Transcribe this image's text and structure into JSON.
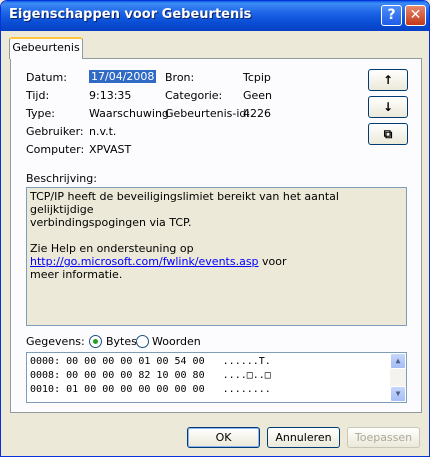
{
  "window": {
    "title": "Eigenschappen voor Gebeurtenis",
    "help_glyph": "?",
    "close_glyph": "✕"
  },
  "tab": {
    "label": "Gebeurtenis"
  },
  "fields": {
    "datum_label": "Datum:",
    "datum_value": "17/04/2008",
    "tijd_label": "Tijd:",
    "tijd_value": "9:13:35",
    "type_label": "Type:",
    "type_value": "Waarschuwing",
    "gebruiker_label": "Gebruiker:",
    "gebruiker_value": "n.v.t.",
    "computer_label": "Computer:",
    "computer_value": "XPVAST",
    "bron_label": "Bron:",
    "bron_value": "Tcpip",
    "categorie_label": "Categorie:",
    "categorie_value": "Geen",
    "gebeurtenis_id_label": "Gebeurtenis-id:",
    "gebeurtenis_id_value": "4226"
  },
  "side_buttons": {
    "up": "↑",
    "down": "↓",
    "copy": "⧉"
  },
  "description": {
    "label": "Beschrijving:",
    "line1": "TCP/IP heeft de beveiligingslimiet bereikt van het aantal gelijktijdige",
    "line2": "verbindingspogingen via TCP.",
    "line3_pre": "Zie Help en ondersteuning op ",
    "link": "http://go.microsoft.com/fwlink/events.asp",
    "line3_post": " voor",
    "line4": "meer informatie."
  },
  "data_section": {
    "label": "Gegevens:",
    "bytes_label": "Bytes",
    "woorden_label": "Woorden",
    "hex_lines": [
      "0000: 00 00 00 00 01 00 54 00   ......T.",
      "0008: 00 00 00 00 82 10 00 80   ....□..□",
      "0010: 01 00 00 00 00 00 00 00   ........"
    ]
  },
  "buttons": {
    "ok": "OK",
    "cancel": "Annuleren",
    "apply": "Toepassen"
  }
}
